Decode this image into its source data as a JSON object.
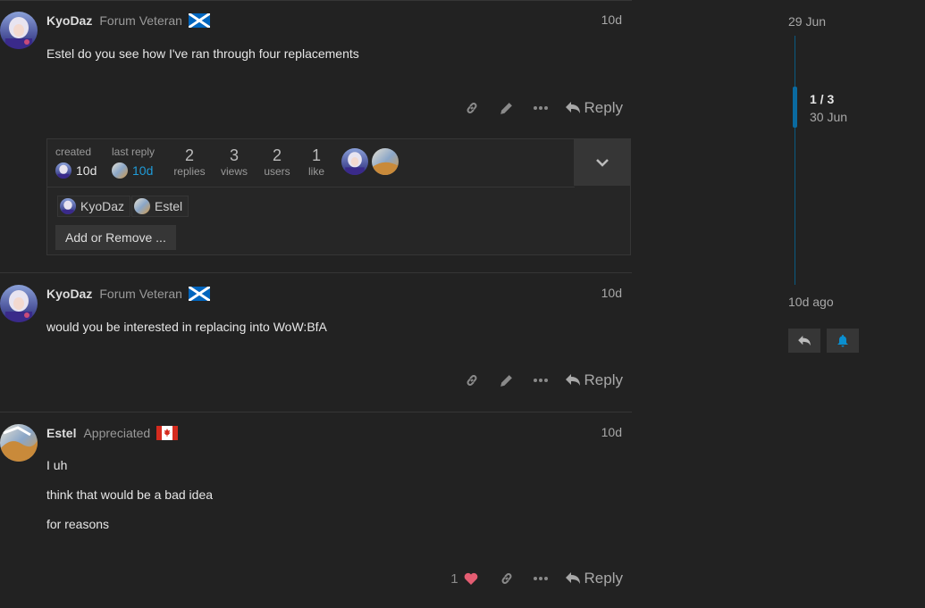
{
  "posts": [
    {
      "username": "KyoDaz",
      "user_title": "Forum Veteran",
      "flag": "scotland-flag",
      "date": "10d",
      "paragraphs": [
        "Estel do you see how I've ran through four replacements"
      ],
      "reply_label": "Reply"
    },
    {
      "username": "KyoDaz",
      "user_title": "Forum Veteran",
      "flag": "scotland-flag",
      "date": "10d",
      "paragraphs": [
        "would you be interested in replacing into WoW:BfA"
      ],
      "reply_label": "Reply"
    },
    {
      "username": "Estel",
      "user_title": "Appreciated",
      "flag": "canada-flag",
      "date": "10d",
      "paragraphs": [
        "I uh",
        "think that would be a bad idea",
        "for reasons"
      ],
      "like_count": "1",
      "reply_label": "Reply"
    }
  ],
  "topic_map": {
    "created_label": "created",
    "created_value": "10d",
    "last_reply_label": "last reply",
    "last_reply_value": "10d",
    "stats": [
      {
        "number": "2",
        "label": "replies"
      },
      {
        "number": "3",
        "label": "views"
      },
      {
        "number": "2",
        "label": "users"
      },
      {
        "number": "1",
        "label": "like"
      }
    ],
    "participants": [
      "KyoDaz",
      "Estel"
    ],
    "add_remove_label": "Add or Remove ..."
  },
  "timeline": {
    "start_date": "29 Jun",
    "position": "1 / 3",
    "position_date": "30 Jun",
    "end_label": "10d ago"
  },
  "colors": {
    "background": "#222222",
    "accent": "#0a6aa0",
    "like_heart": "#e45d72",
    "last_reply_link": "#1f9bd8"
  }
}
